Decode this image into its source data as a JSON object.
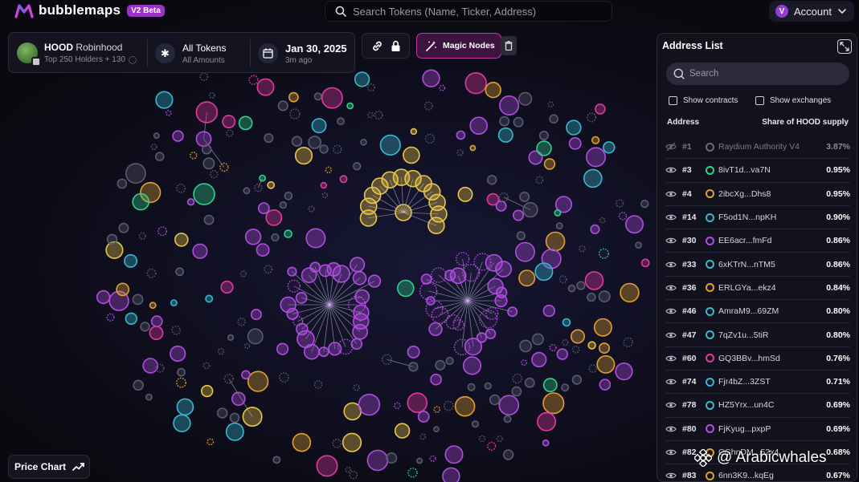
{
  "app": {
    "name": "bubblemaps",
    "badge": "V2 Beta"
  },
  "search": {
    "placeholder": "Search Tokens (Name, Ticker, Address)"
  },
  "account": {
    "avatar_letter": "V",
    "label": "Account"
  },
  "token": {
    "ticker": "HOOD",
    "name": "Robinhood",
    "holders": "Top 250 Holders + 130"
  },
  "filter": {
    "title": "All Tokens",
    "subtitle": "All Amounts"
  },
  "date": {
    "title": "Jan 30, 2025",
    "subtitle": "3m ago"
  },
  "magic_nodes": {
    "label": "Magic Nodes"
  },
  "address_list": {
    "title": "Address List",
    "search_placeholder": "Search",
    "show_contracts": "Show contracts",
    "show_exchanges": "Show exchanges",
    "col_address": "Address",
    "col_share": "Share of HOOD supply",
    "rows": [
      {
        "rank": "#1",
        "address": "Raydium Authority V4",
        "share": "3.87%",
        "color": "#6a6a78",
        "dim": true
      },
      {
        "rank": "#3",
        "address": "8ivT1d...va7N",
        "share": "0.95%",
        "color": "#2ed18a"
      },
      {
        "rank": "#4",
        "address": "2ibcXg...Dhs8",
        "share": "0.95%",
        "color": "#e0a030"
      },
      {
        "rank": "#14",
        "address": "F5od1N...npKH",
        "share": "0.90%",
        "color": "#38b8d0"
      },
      {
        "rank": "#30",
        "address": "EE6acr...fmFd",
        "share": "0.86%",
        "color": "#b04ee0"
      },
      {
        "rank": "#33",
        "address": "6xKTrN...nTM5",
        "share": "0.86%",
        "color": "#38b8d0"
      },
      {
        "rank": "#36",
        "address": "ERLGYa...ekz4",
        "share": "0.84%",
        "color": "#e0a030"
      },
      {
        "rank": "#46",
        "address": "AmraM9...69ZM",
        "share": "0.80%",
        "color": "#38b8d0"
      },
      {
        "rank": "#47",
        "address": "7qZv1u...5tiR",
        "share": "0.80%",
        "color": "#38b8d0"
      },
      {
        "rank": "#60",
        "address": "GQ3BBv...hmSd",
        "share": "0.76%",
        "color": "#e03aa0"
      },
      {
        "rank": "#74",
        "address": "Fjr4bZ...3ZST",
        "share": "0.71%",
        "color": "#38b8d0"
      },
      {
        "rank": "#78",
        "address": "HZ5Yrx...un4C",
        "share": "0.69%",
        "color": "#38b8d0"
      },
      {
        "rank": "#80",
        "address": "FjKyug...pxpP",
        "share": "0.69%",
        "color": "#b04ee0"
      },
      {
        "rank": "#82",
        "address": "CGhnDM...52x4",
        "share": "0.68%",
        "color": "#e0a030"
      },
      {
        "rank": "#83",
        "address": "6nn3K9...kqEg",
        "share": "0.67%",
        "color": "#e0a030"
      }
    ]
  },
  "price_chart": {
    "label": "Price Chart"
  },
  "watermark": {
    "text": "@ Arabicwhales"
  },
  "colors": {
    "purple": "#b04ee0",
    "yellow": "#e8c64a",
    "teal": "#38b8d0",
    "green": "#2ed18a",
    "orange": "#e0a030",
    "magenta": "#e03aa0",
    "gray": "#5a5a70"
  }
}
